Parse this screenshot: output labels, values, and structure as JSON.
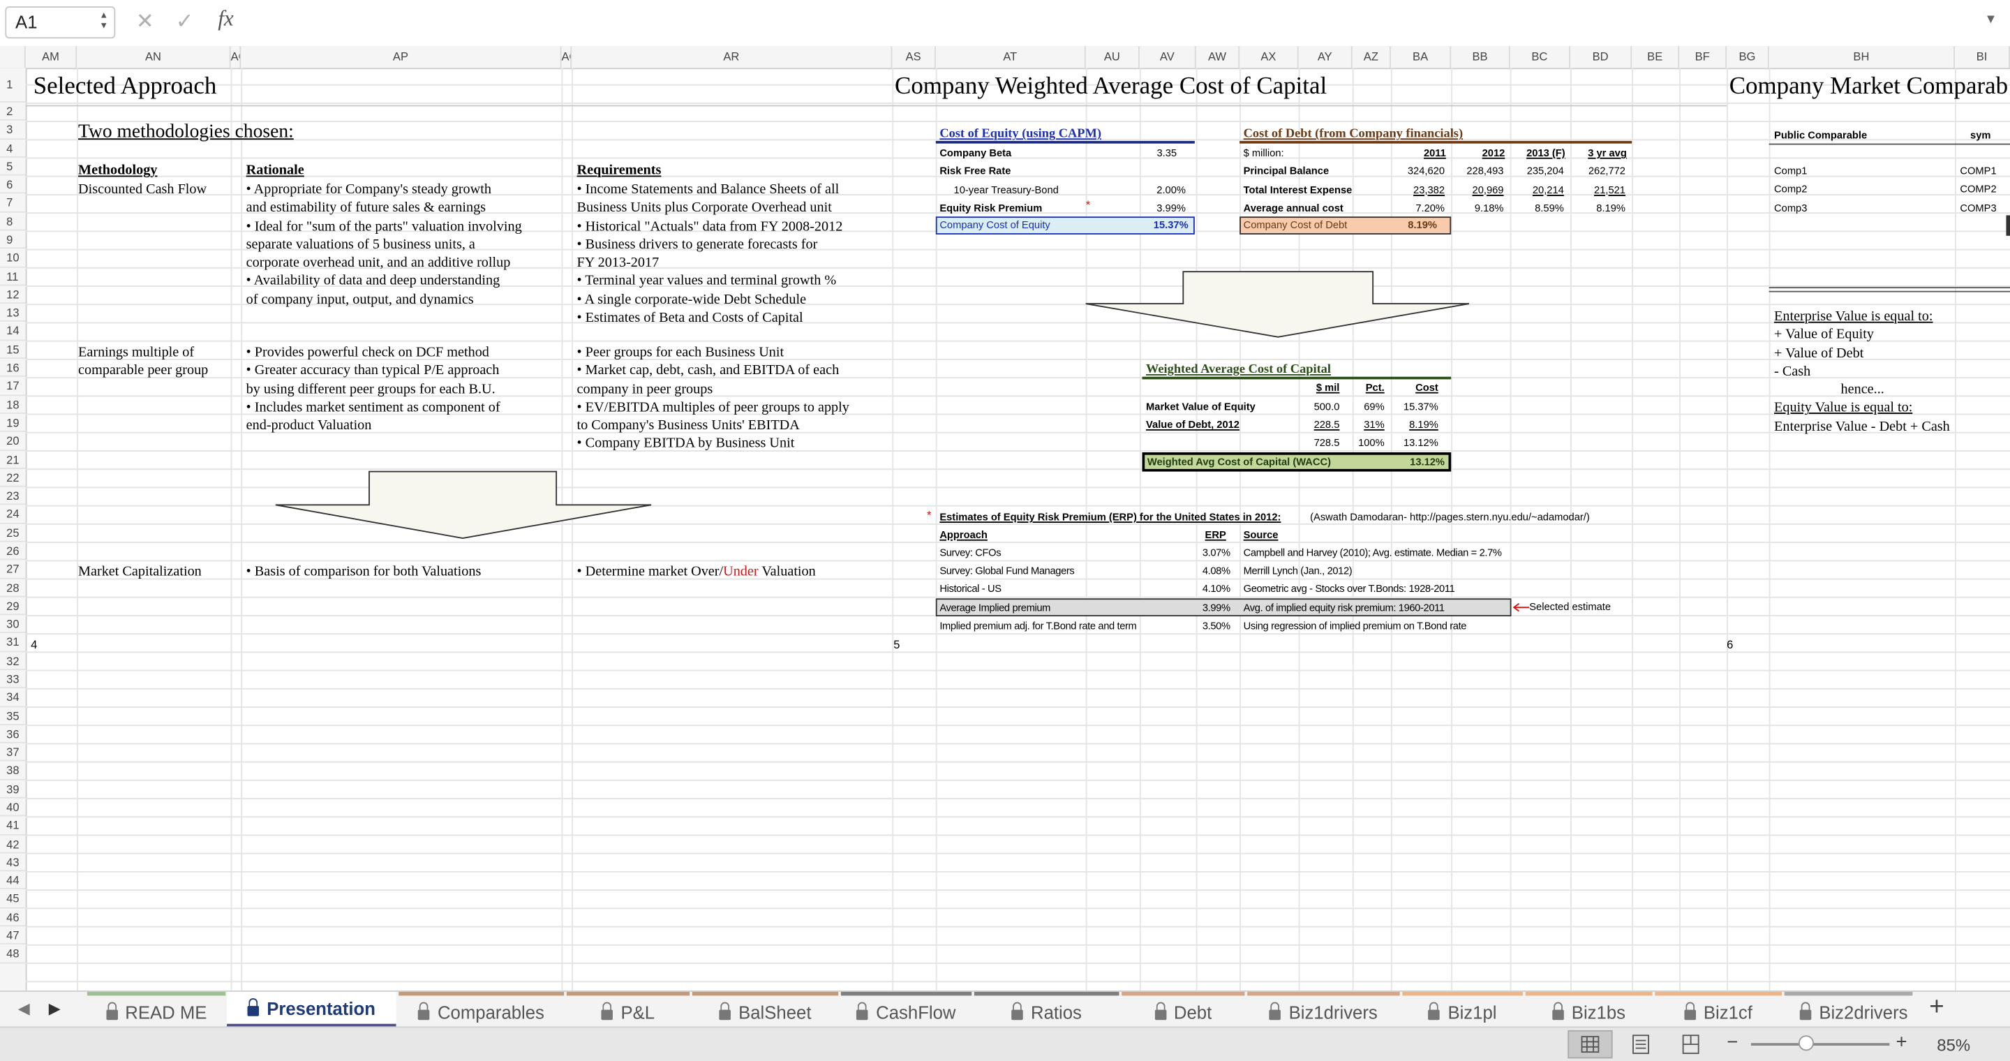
{
  "formula_bar": {
    "cell_ref": "A1",
    "cancel_icon": "✕",
    "confirm_icon": "✓",
    "fx_label": "fx",
    "formula_value": ""
  },
  "columns": [
    "AM",
    "AN",
    "AO",
    "AP",
    "AQ",
    "AR",
    "AS",
    "AT",
    "AU",
    "AV",
    "AW",
    "AX",
    "AY",
    "AZ",
    "BA",
    "BB",
    "BC",
    "BD",
    "BE",
    "BF",
    "BG",
    "BH",
    "BI"
  ],
  "rows": [
    "1",
    "2",
    "3",
    "4",
    "5",
    "6",
    "7",
    "8",
    "9",
    "10",
    "11",
    "12",
    "13",
    "14",
    "15",
    "16",
    "17",
    "18",
    "19",
    "20",
    "21",
    "22",
    "23",
    "24",
    "25",
    "26",
    "27",
    "28",
    "29",
    "30",
    "31",
    "32",
    "33",
    "34",
    "35",
    "36",
    "37",
    "38",
    "39",
    "40",
    "41",
    "42",
    "43",
    "44",
    "45",
    "46",
    "47",
    "48"
  ],
  "slide_numbers": [
    "4",
    "5",
    "6"
  ],
  "left": {
    "title": "Selected Approach",
    "subtitle": "Two methodologies chosen:",
    "headers": {
      "methodology": "Methodology",
      "rationale": "Rationale",
      "requirements": "Requirements"
    },
    "dcf": {
      "name": "Discounted Cash Flow",
      "rationale": [
        "• Appropriate for Company's steady growth",
        "   and estimability of future sales & earnings",
        "• Ideal for \"sum of the parts\" valuation involving",
        "   separate valuations of 5 business units, a",
        "   corporate overhead unit, and an additive rollup",
        "• Availability of data and deep understanding",
        "   of company input, output, and dynamics"
      ],
      "requirements": [
        "• Income Statements and Balance Sheets of all",
        "   Business Units plus Corporate Overhead unit",
        "• Historical \"Actuals\" data from FY 2008-2012",
        "• Business drivers to generate forecasts for",
        "   FY 2013-2017",
        "• Terminal year values and terminal growth %",
        "• A single corporate-wide Debt Schedule",
        "• Estimates of Beta and Costs of Capital"
      ]
    },
    "multiple": {
      "name": [
        "Earnings multiple of",
        "comparable peer group"
      ],
      "rationale": [
        "• Provides powerful check on DCF method",
        "• Greater accuracy than typical P/E approach",
        "   by using different peer groups for each B.U.",
        "• Includes market sentiment as component of",
        "   end-product Valuation"
      ],
      "requirements": [
        "• Peer groups for each Business Unit",
        "• Market cap, debt, cash, and EBITDA of each",
        "   company in peer groups",
        "• EV/EBITDA multiples of peer groups to apply",
        "   to Company's Business Units' EBITDA",
        "• Company EBITDA by Business Unit"
      ]
    },
    "market_cap": {
      "name": "Market Capitalization",
      "rationale": "• Basis of comparison for both Valuations",
      "req_prefix": "• Determine market Over/",
      "req_under": "Under",
      "req_suffix": " Valuation"
    }
  },
  "wacc": {
    "title": "Company Weighted Average Cost of Capital",
    "coe": {
      "title": "Cost of Equity (using CAPM)",
      "rows": [
        [
          "Company Beta",
          "3.35"
        ],
        [
          "Risk Free Rate",
          ""
        ],
        [
          "   10-year Treasury-Bond",
          "2.00%"
        ],
        [
          "Equity Risk Premium",
          "3.99%"
        ]
      ],
      "star": "*",
      "result_label": "Company Cost of Equity",
      "result_value": "15.37%"
    },
    "cod": {
      "title": "Cost of Debt (from Company financials)",
      "unit": "$ million:",
      "years": [
        "2011",
        "2012",
        "2013 (F)",
        "3 yr avg"
      ],
      "rows": [
        {
          "label": "Principal Balance",
          "values": [
            "324,620",
            "228,493",
            "235,204",
            "262,772"
          ]
        },
        {
          "label": "Total Interest Expense",
          "values": [
            "23,382",
            "20,969",
            "20,214",
            "21,521"
          ]
        },
        {
          "label": "Average annual cost",
          "values": [
            "7.20%",
            "9.18%",
            "8.59%",
            "8.19%"
          ]
        }
      ],
      "result_label": "Company Cost of Debt",
      "result_value": "8.19%"
    },
    "table": {
      "title": "Weighted Average Cost of Capital",
      "headers": [
        "$ mil",
        "Pct.",
        "Cost"
      ],
      "rows": [
        {
          "label": "Market Value of Equity",
          "values": [
            "500.0",
            "69%",
            "15.37%"
          ]
        },
        {
          "label": "Value of Debt, 2012",
          "values": [
            "228.5",
            "31%",
            "8.19%"
          ]
        },
        {
          "label": "",
          "values": [
            "728.5",
            "100%",
            "13.12%"
          ]
        }
      ],
      "result_label": "Weighted Avg Cost of Capital (WACC)",
      "result_value": "13.12%"
    },
    "erp": {
      "star": "*",
      "title": "Estimates of Equity Risk Premium (ERP) for the United States in 2012:",
      "source_note": "(Aswath Damodaran- http://pages.stern.nyu.edu/~adamodar/)",
      "headers": [
        "Approach",
        "ERP",
        "Source"
      ],
      "rows": [
        [
          "Survey: CFOs",
          "3.07%",
          "Campbell and Harvey (2010); Avg. estimate. Median = 2.7%"
        ],
        [
          "Survey: Global Fund Managers",
          "4.08%",
          "Merrill Lynch (Jan., 2012)"
        ],
        [
          "Historical - US",
          "4.10%",
          "Geometric avg - Stocks over T.Bonds: 1928-2011"
        ],
        [
          "Average Implied premium",
          "3.99%",
          "Avg. of implied equity risk premium: 1960-2011"
        ],
        [
          "Implied premium adj. for T.Bond rate and term",
          "3.50%",
          "Using regression of implied premium on T.Bond rate"
        ]
      ],
      "selected_note": "Selected estimate"
    }
  },
  "right": {
    "title": "Company Market Comparab",
    "headers": [
      "Public Comparable",
      "sym"
    ],
    "rows": [
      [
        "Comp1",
        "COMP1"
      ],
      [
        "Comp2",
        "COMP2"
      ],
      [
        "Comp3",
        "COMP3"
      ]
    ],
    "ev_lines": [
      "Enterprise Value is equal to:",
      "+ Value of Equity",
      "+ Value of Debt",
      "-  Cash",
      "hence...",
      "Equity Value is equal to:",
      "Enterprise Value - Debt + Cash"
    ]
  },
  "tabs": [
    "READ ME",
    "Presentation",
    "Comparables",
    "P&L",
    "BalSheet",
    "CashFlow",
    "Ratios",
    "Debt",
    "Biz1drivers",
    "Biz1pl",
    "Biz1bs",
    "Biz1cf",
    "Biz2drivers"
  ],
  "active_tab": "Presentation",
  "tab_colors": [
    "#9bc38f",
    "#4e4f8f",
    "#c49a78",
    "#c49a78",
    "#c49a78",
    "#7f7f7f",
    "#7f7f7f",
    "#d9a482",
    "#d9a482",
    "#f2b483",
    "#f2b483",
    "#f2b483",
    "#aaaaaa"
  ],
  "status": {
    "zoom": "85%"
  }
}
